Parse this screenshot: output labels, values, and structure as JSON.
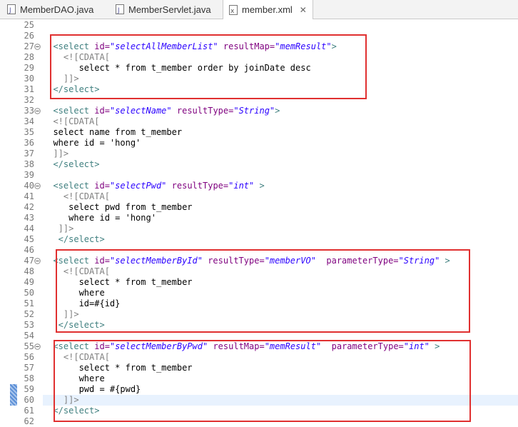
{
  "tabs": [
    {
      "label": "MemberDAO.java",
      "icon": "java-file-icon",
      "active": false
    },
    {
      "label": "MemberServlet.java",
      "icon": "java-file-icon",
      "active": false
    },
    {
      "label": "member.xml",
      "icon": "xml-file-icon",
      "active": true
    }
  ],
  "close_glyph": "✕",
  "lines": [
    {
      "n": "25",
      "fold": false,
      "segs": []
    },
    {
      "n": "26",
      "fold": false,
      "segs": []
    },
    {
      "n": "27",
      "fold": true,
      "segs": [
        [
          "tag",
          "  <select "
        ],
        [
          "attr",
          "id="
        ],
        [
          "val",
          "\"selectAllMemberList\""
        ],
        [
          "attr",
          " resultMap="
        ],
        [
          "val",
          "\"memResult\""
        ],
        [
          "tag",
          ">"
        ]
      ]
    },
    {
      "n": "28",
      "fold": false,
      "segs": [
        [
          "cdata",
          "    <![CDATA["
        ]
      ]
    },
    {
      "n": "29",
      "fold": false,
      "segs": [
        [
          "txt",
          "       select * from t_member order by joinDate desc"
        ]
      ]
    },
    {
      "n": "30",
      "fold": false,
      "segs": [
        [
          "cdata",
          "    ]]>"
        ]
      ]
    },
    {
      "n": "31",
      "fold": false,
      "segs": [
        [
          "tag",
          "  </select>"
        ]
      ]
    },
    {
      "n": "32",
      "fold": false,
      "segs": []
    },
    {
      "n": "33",
      "fold": true,
      "segs": [
        [
          "tag",
          "  <select "
        ],
        [
          "attr",
          "id="
        ],
        [
          "val",
          "\"selectName\""
        ],
        [
          "attr",
          " resultType="
        ],
        [
          "val",
          "\"String\""
        ],
        [
          "tag",
          ">"
        ]
      ]
    },
    {
      "n": "34",
      "fold": false,
      "segs": [
        [
          "cdata",
          "  <![CDATA["
        ]
      ]
    },
    {
      "n": "35",
      "fold": false,
      "segs": [
        [
          "txt",
          "  select name from t_member"
        ]
      ]
    },
    {
      "n": "36",
      "fold": false,
      "segs": [
        [
          "txt",
          "  where id = 'hong'"
        ]
      ]
    },
    {
      "n": "37",
      "fold": false,
      "segs": [
        [
          "cdata",
          "  ]]>"
        ]
      ]
    },
    {
      "n": "38",
      "fold": false,
      "segs": [
        [
          "tag",
          "  </select>"
        ]
      ]
    },
    {
      "n": "39",
      "fold": false,
      "segs": []
    },
    {
      "n": "40",
      "fold": true,
      "segs": [
        [
          "tag",
          "  <select "
        ],
        [
          "attr",
          "id="
        ],
        [
          "val",
          "\"selectPwd\""
        ],
        [
          "attr",
          " resultType="
        ],
        [
          "val",
          "\"int\""
        ],
        [
          "tag",
          " >"
        ]
      ]
    },
    {
      "n": "41",
      "fold": false,
      "segs": [
        [
          "cdata",
          "    <![CDATA["
        ]
      ]
    },
    {
      "n": "42",
      "fold": false,
      "segs": [
        [
          "txt",
          "     select pwd from t_member"
        ]
      ]
    },
    {
      "n": "43",
      "fold": false,
      "segs": [
        [
          "txt",
          "     where id = 'hong'"
        ]
      ]
    },
    {
      "n": "44",
      "fold": false,
      "segs": [
        [
          "cdata",
          "   ]]>"
        ]
      ]
    },
    {
      "n": "45",
      "fold": false,
      "segs": [
        [
          "tag",
          "   </select>"
        ]
      ]
    },
    {
      "n": "46",
      "fold": false,
      "segs": []
    },
    {
      "n": "47",
      "fold": true,
      "segs": [
        [
          "tag",
          "  <select "
        ],
        [
          "attr",
          "id="
        ],
        [
          "val",
          "\"selectMemberById\""
        ],
        [
          "attr",
          " resultType="
        ],
        [
          "val",
          "\"memberVO\""
        ],
        [
          "attr",
          "  parameterType="
        ],
        [
          "val",
          "\"String\""
        ],
        [
          "tag",
          " >"
        ]
      ]
    },
    {
      "n": "48",
      "fold": false,
      "segs": [
        [
          "cdata",
          "    <![CDATA["
        ]
      ]
    },
    {
      "n": "49",
      "fold": false,
      "segs": [
        [
          "txt",
          "       select * from t_member"
        ]
      ]
    },
    {
      "n": "50",
      "fold": false,
      "segs": [
        [
          "txt",
          "       where"
        ]
      ]
    },
    {
      "n": "51",
      "fold": false,
      "segs": [
        [
          "txt",
          "       id=#{id}"
        ]
      ]
    },
    {
      "n": "52",
      "fold": false,
      "segs": [
        [
          "cdata",
          "    ]]>"
        ]
      ]
    },
    {
      "n": "53",
      "fold": false,
      "segs": [
        [
          "tag",
          "   </select>"
        ]
      ]
    },
    {
      "n": "54",
      "fold": false,
      "segs": []
    },
    {
      "n": "55",
      "fold": true,
      "segs": [
        [
          "tag",
          "  <select "
        ],
        [
          "attr",
          "id="
        ],
        [
          "val",
          "\"selectMemberByPwd\""
        ],
        [
          "attr",
          " resultMap="
        ],
        [
          "val",
          "\"memResult\""
        ],
        [
          "attr",
          "  parameterType="
        ],
        [
          "val",
          "\"int\""
        ],
        [
          "tag",
          " >"
        ]
      ]
    },
    {
      "n": "56",
      "fold": false,
      "segs": [
        [
          "cdata",
          "    <![CDATA["
        ]
      ]
    },
    {
      "n": "57",
      "fold": false,
      "segs": [
        [
          "txt",
          "       select * from t_member"
        ]
      ]
    },
    {
      "n": "58",
      "fold": false,
      "segs": [
        [
          "txt",
          "       where"
        ]
      ]
    },
    {
      "n": "59",
      "fold": false,
      "segs": [
        [
          "txt",
          "       pwd = #{pwd}"
        ]
      ]
    },
    {
      "n": "60",
      "fold": false,
      "segs": [
        [
          "cdata",
          "    ]]>"
        ]
      ]
    },
    {
      "n": "61",
      "fold": false,
      "segs": [
        [
          "tag",
          "  </select>"
        ]
      ]
    },
    {
      "n": "62",
      "fold": false,
      "segs": []
    }
  ],
  "current_line": "60",
  "highlight_color": "#e03030"
}
